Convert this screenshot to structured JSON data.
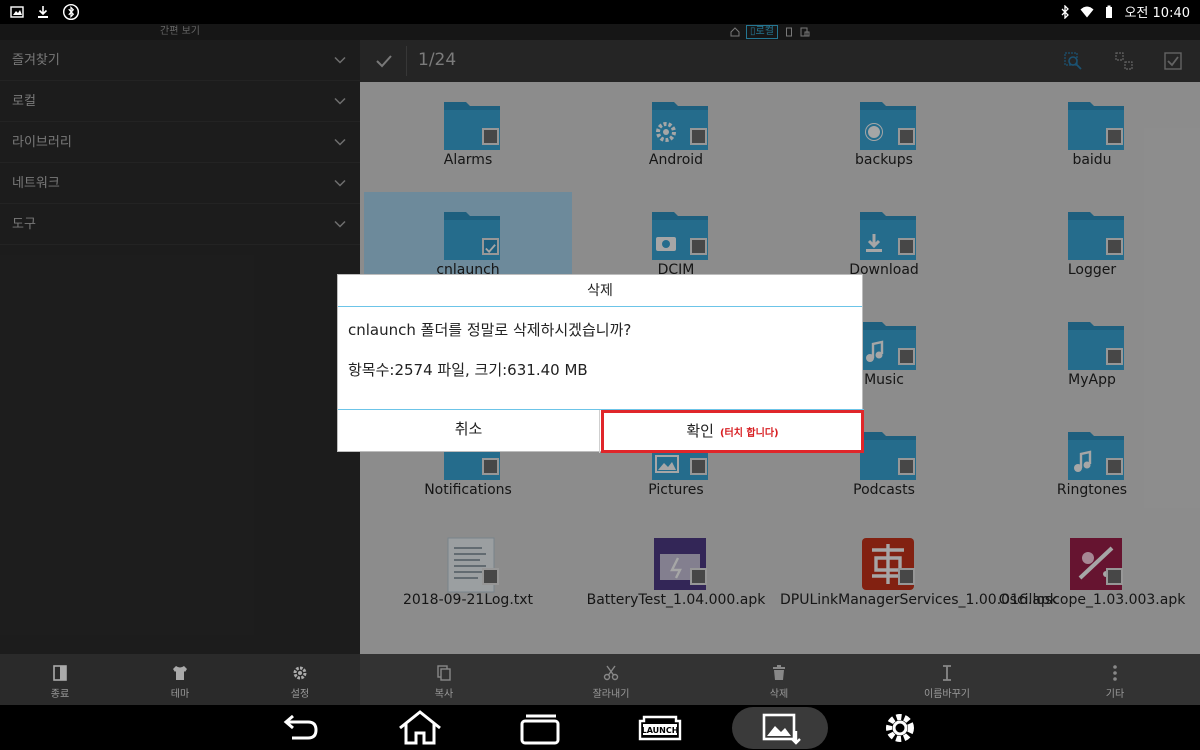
{
  "status_bar": {
    "time": "오전 10:40"
  },
  "left_panel": {
    "title": "간편 보기",
    "items": [
      {
        "label": "즐겨찾기"
      },
      {
        "label": "로컬"
      },
      {
        "label": "라이브러리"
      },
      {
        "label": "네트워크"
      },
      {
        "label": "도구"
      }
    ]
  },
  "location_bar": {
    "active_label": "로컬"
  },
  "toolbar": {
    "selection_count": "1/24"
  },
  "files": [
    {
      "name": "Alarms",
      "type": "folder",
      "icon": "folder-icon"
    },
    {
      "name": "Android",
      "type": "folder",
      "icon": "gear-folder-icon"
    },
    {
      "name": "backups",
      "type": "folder",
      "icon": "backup-folder-icon"
    },
    {
      "name": "baidu",
      "type": "folder",
      "icon": "folder-icon"
    },
    {
      "name": "cnlaunch",
      "type": "folder",
      "icon": "folder-icon",
      "selected": true
    },
    {
      "name": "DCIM",
      "type": "folder",
      "icon": "camera-folder-icon"
    },
    {
      "name": "Download",
      "type": "folder",
      "icon": "download-folder-icon"
    },
    {
      "name": "Logger",
      "type": "folder",
      "icon": "folder-icon"
    },
    {
      "name": "",
      "type": "folder",
      "icon": "folder-icon"
    },
    {
      "name": "",
      "type": "folder",
      "icon": "folder-icon"
    },
    {
      "name": "Music",
      "type": "folder",
      "icon": "music-folder-icon"
    },
    {
      "name": "MyApp",
      "type": "folder",
      "icon": "folder-icon"
    },
    {
      "name": "Notifications",
      "type": "folder",
      "icon": "folder-icon"
    },
    {
      "name": "Pictures",
      "type": "folder",
      "icon": "picture-folder-icon"
    },
    {
      "name": "Podcasts",
      "type": "folder",
      "icon": "folder-icon"
    },
    {
      "name": "Ringtones",
      "type": "folder",
      "icon": "music-folder-icon"
    },
    {
      "name": "2018-09-21Log.txt",
      "type": "txt",
      "icon": "text-file-icon"
    },
    {
      "name": "BatteryTest_1.04.000.apk",
      "type": "apk",
      "icon": "battery-app-icon"
    },
    {
      "name": "DPULinkManagerServices_1.00.016.apk",
      "type": "apk",
      "icon": "dpu-app-icon"
    },
    {
      "name": "Oscilloscope_1.03.003.apk",
      "type": "apk",
      "icon": "oscilloscope-app-icon"
    }
  ],
  "bottom_left": [
    {
      "label": "종료",
      "icon": "exit-icon"
    },
    {
      "label": "테마",
      "icon": "shirt-icon"
    },
    {
      "label": "설정",
      "icon": "settings-icon"
    }
  ],
  "bottom_right": [
    {
      "label": "복사",
      "icon": "copy-icon"
    },
    {
      "label": "잘라내기",
      "icon": "scissors-icon"
    },
    {
      "label": "삭제",
      "icon": "trash-icon"
    },
    {
      "label": "이름바꾸기",
      "icon": "rename-icon"
    },
    {
      "label": "기타",
      "icon": "more-icon"
    }
  ],
  "dialog": {
    "title": "삭제",
    "message": "cnlaunch 폴더를 정말로 삭제하시겠습니까?",
    "details": "항목수:2574 파일, 크기:631.40 MB",
    "cancel_label": "취소",
    "confirm_label": "확인",
    "confirm_note": "(터치 합니다)"
  },
  "nav": {
    "launch_label": "LAUNCH"
  },
  "colors": {
    "folder": "#3aa7d8",
    "accent": "#6cc4e8",
    "highlight_red": "#e0262a"
  }
}
